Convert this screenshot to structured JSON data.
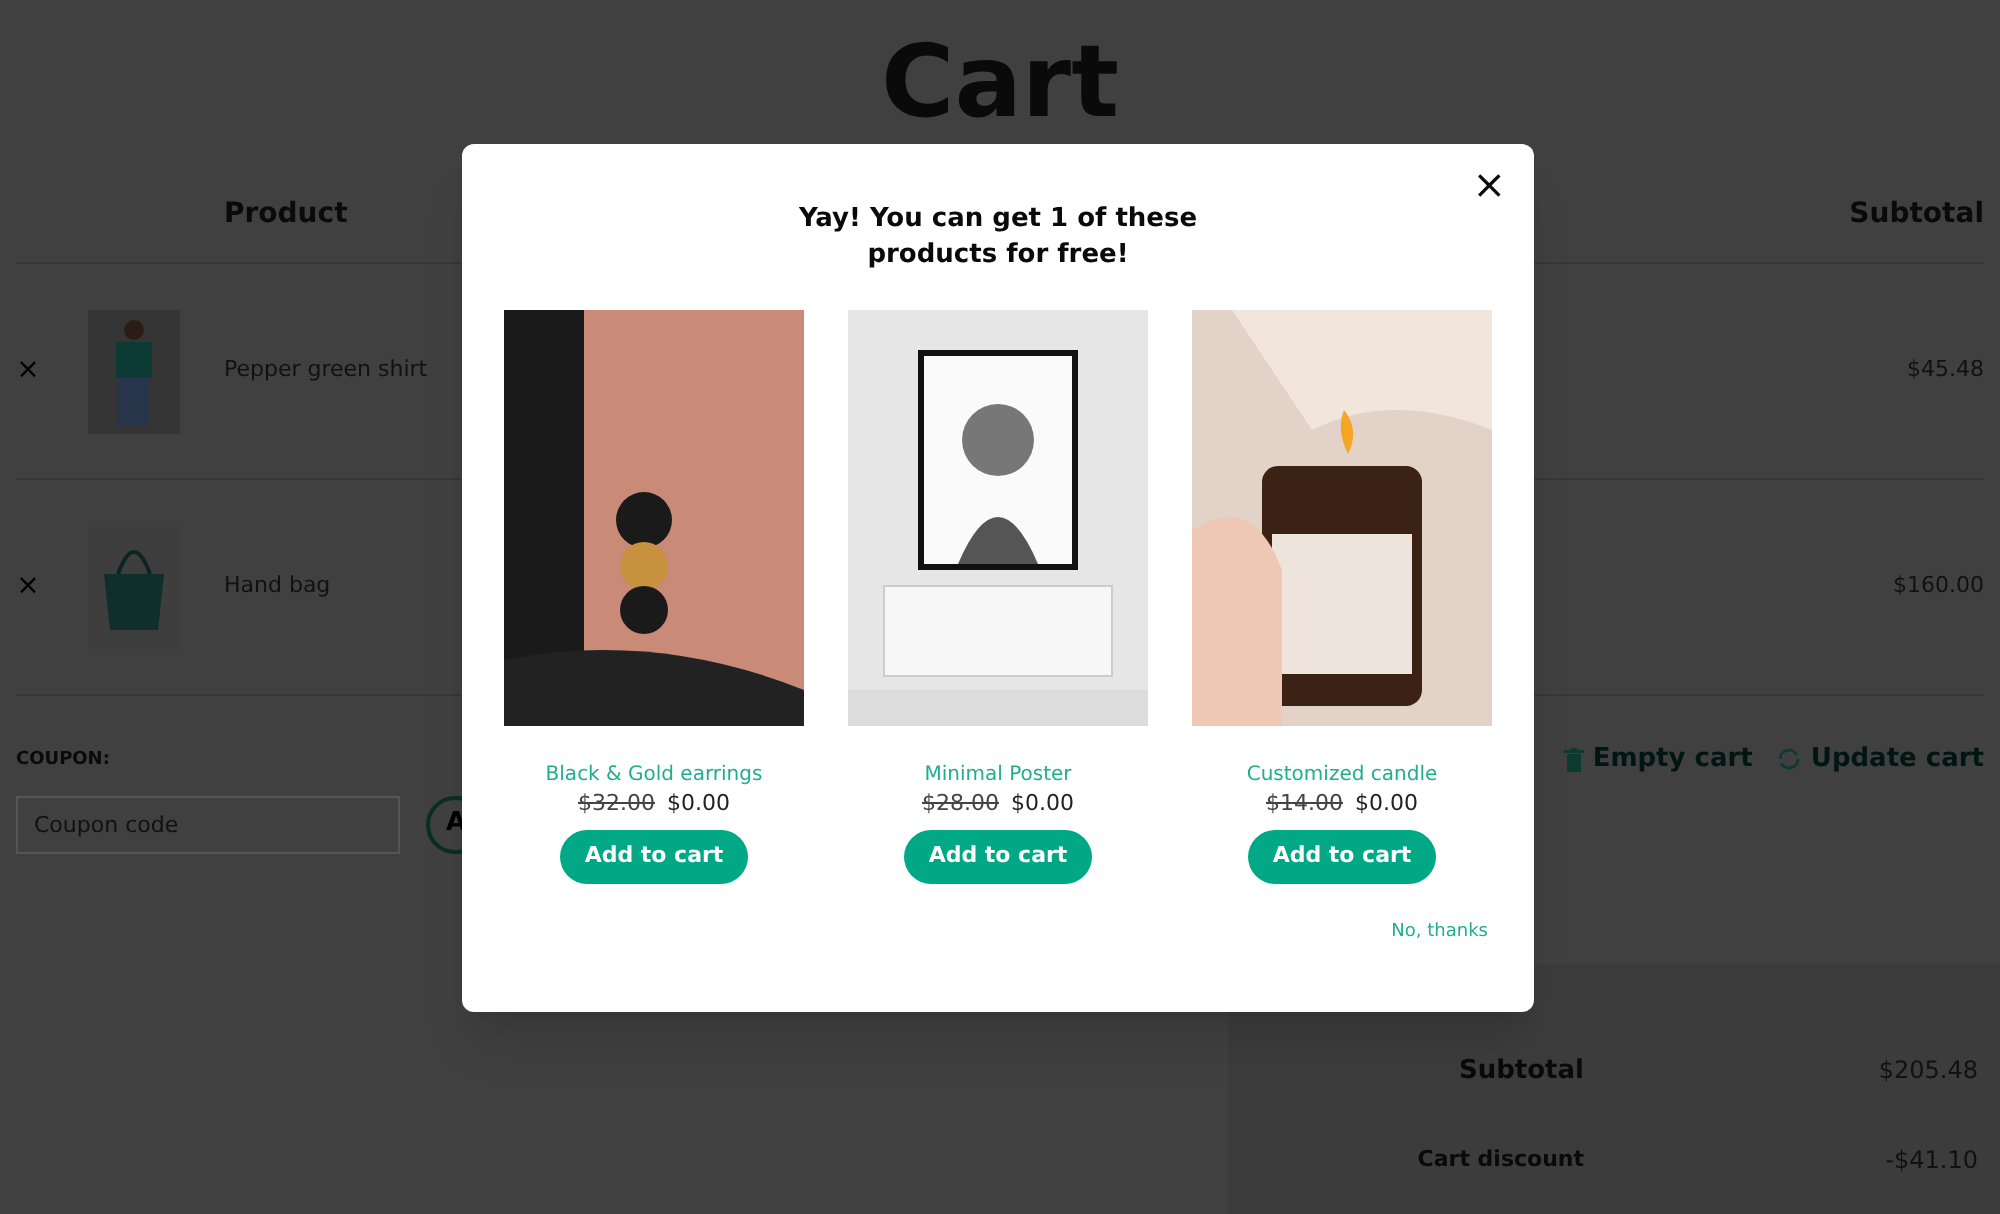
{
  "page": {
    "title": "Cart"
  },
  "cart_table": {
    "columns": [
      "Product",
      "Subtotal"
    ],
    "rows": [
      {
        "remove": "×",
        "product": "Pepper green shirt",
        "subtotal": "$45.48",
        "kind": "shirt"
      },
      {
        "remove": "×",
        "product": "Hand bag",
        "subtotal": "$160.00",
        "kind": "bag"
      }
    ]
  },
  "coupon": {
    "label": "COUPON:",
    "placeholder": "Coupon code",
    "button": "A"
  },
  "cart_actions": [
    {
      "label": "Empty cart",
      "kind": "trash"
    },
    {
      "label": "Update cart",
      "kind": "refresh"
    }
  ],
  "totals": [
    {
      "label": "Subtotal",
      "value": "$205.48"
    },
    {
      "label": "Cart discount",
      "value": "-$41.10"
    }
  ],
  "modal": {
    "title": "Yay! You can get 1 of these products for free!",
    "close": "×",
    "products": [
      {
        "name": "Black & Gold earrings",
        "old_price": "$32.00",
        "price": "$0.00",
        "button": "Add to cart"
      },
      {
        "name": "Minimal Poster",
        "old_price": "$28.00",
        "price": "$0.00",
        "button": "Add to cart"
      },
      {
        "name": "Customized candle",
        "old_price": "$14.00",
        "price": "$0.00",
        "button": "Add to cart"
      }
    ],
    "decline": "No, thanks"
  }
}
